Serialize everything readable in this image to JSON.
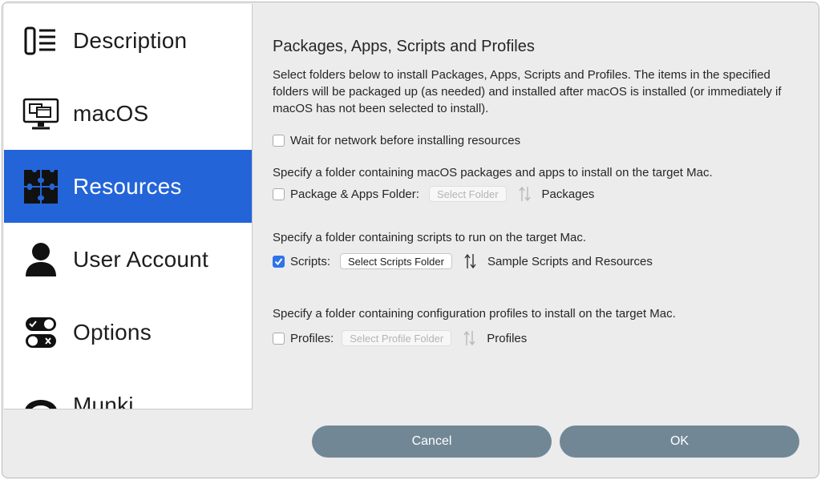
{
  "sidebar": {
    "items": [
      {
        "label": "Description",
        "icon": "description-icon"
      },
      {
        "label": "macOS",
        "icon": "monitor-icon"
      },
      {
        "label": "Resources",
        "icon": "puzzle-icon",
        "selected": true
      },
      {
        "label": "User Account",
        "icon": "user-icon"
      },
      {
        "label": "Options",
        "icon": "toggles-icon"
      },
      {
        "label": "Munki",
        "icon": "munki-icon"
      }
    ]
  },
  "main": {
    "title": "Packages, Apps, Scripts and Profiles",
    "description": "Select folders below to install Packages, Apps, Scripts and Profiles. The items in the specified folders will be packaged up (as needed) and installed after macOS is installed (or immediately if macOS has not been selected to install).",
    "wait_network": {
      "label": "Wait for network before installing resources",
      "checked": false
    },
    "packages": {
      "instruction": "Specify a folder containing macOS packages and apps to install on the target Mac.",
      "label": "Package & Apps Folder:",
      "button": "Select Folder",
      "value": "Packages",
      "checked": false
    },
    "scripts": {
      "instruction": "Specify a folder containing scripts to run on the target Mac.",
      "label": "Scripts:",
      "button": "Select Scripts Folder",
      "value": "Sample Scripts and Resources",
      "checked": true
    },
    "profiles": {
      "instruction": "Specify a folder containing configuration profiles to install on the target Mac.",
      "label": "Profiles:",
      "button": "Select Profile Folder",
      "value": "Profiles",
      "checked": false
    }
  },
  "footer": {
    "cancel": "Cancel",
    "ok": "OK"
  },
  "colors": {
    "selection": "#2364d8",
    "checkbox_checked": "#2f73ea",
    "footer_button": "#718796"
  }
}
